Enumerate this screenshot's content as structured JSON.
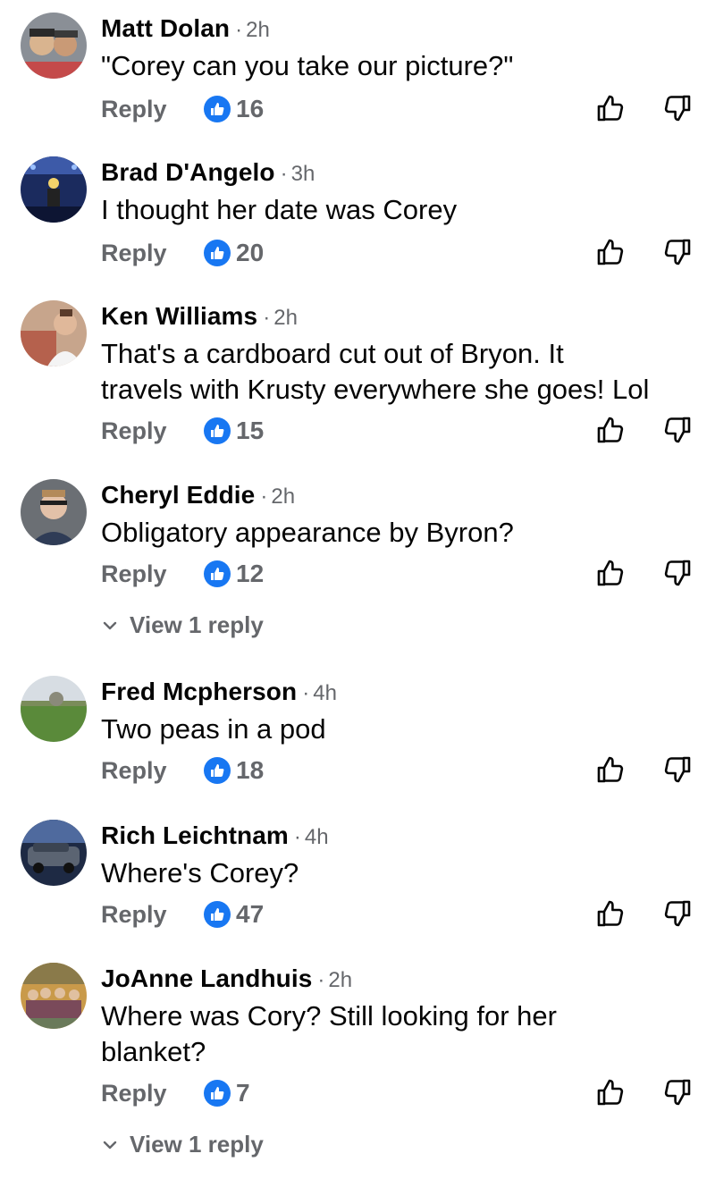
{
  "comments": [
    {
      "name": "Matt Dolan",
      "time": "2h",
      "text": [
        "\"Corey can you take our picture?\""
      ],
      "reply_label": "Reply",
      "likes": "16",
      "avatar": "two-people-selfie"
    },
    {
      "name": "Brad D'Angelo",
      "time": "3h",
      "text": [
        "I thought her date was Corey"
      ],
      "reply_label": "Reply",
      "likes": "20",
      "avatar": "concert-stage"
    },
    {
      "name": "Ken Williams",
      "time": "2h",
      "text": [
        "That's a cardboard cut out of Bryon. It",
        "travels with Krusty everywhere she goes! Lol"
      ],
      "reply_label": "Reply",
      "likes": "15",
      "avatar": "man-on-couch"
    },
    {
      "name": "Cheryl Eddie",
      "time": "2h",
      "text": [
        "Obligatory appearance by Byron?"
      ],
      "reply_label": "Reply",
      "likes": "12",
      "avatar": "man-with-glasses",
      "view_replies": "View 1 reply"
    },
    {
      "name": "Fred Mcpherson",
      "time": "4h",
      "text": [
        "Two peas in a pod"
      ],
      "reply_label": "Reply",
      "likes": "18",
      "avatar": "landscape-field"
    },
    {
      "name": "Rich Leichtnam",
      "time": "4h",
      "text": [
        "Where's Corey?"
      ],
      "reply_label": "Reply",
      "likes": "47",
      "avatar": "suv-car"
    },
    {
      "name": "JoAnne Landhuis",
      "time": "2h",
      "text": [
        "Where was Cory? Still looking for her",
        "blanket?"
      ],
      "reply_label": "Reply",
      "likes": "7",
      "avatar": "family-group",
      "view_replies": "View 1 reply"
    }
  ],
  "colors": {
    "like_blue": "#1877f2",
    "secondary_text": "#65676b",
    "primary_text": "#050505"
  },
  "icons": {
    "like_badge": "thumbs-up-icon",
    "like_button": "thumbs-up-outline-icon",
    "dislike_button": "thumbs-down-outline-icon",
    "expand": "chevron-down-icon"
  }
}
